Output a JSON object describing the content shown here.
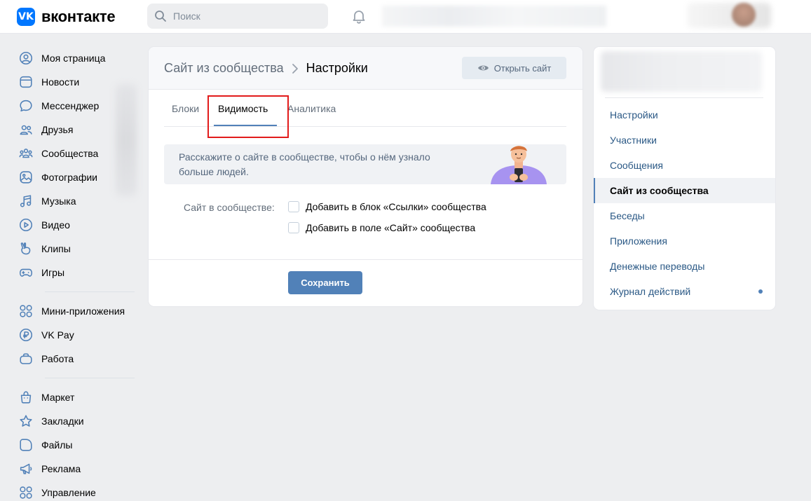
{
  "header": {
    "logo_badge": "VK",
    "logo_text": "вконтакте",
    "search_placeholder": "Поиск"
  },
  "nav": {
    "group1": [
      {
        "label": "Моя страница",
        "icon": "user-circle-icon"
      },
      {
        "label": "Новости",
        "icon": "news-icon"
      },
      {
        "label": "Мессенджер",
        "icon": "message-icon"
      },
      {
        "label": "Друзья",
        "icon": "friends-icon"
      },
      {
        "label": "Сообщества",
        "icon": "communities-icon"
      },
      {
        "label": "Фотографии",
        "icon": "photo-icon"
      },
      {
        "label": "Музыка",
        "icon": "music-icon"
      },
      {
        "label": "Видео",
        "icon": "video-icon"
      },
      {
        "label": "Клипы",
        "icon": "clips-icon"
      },
      {
        "label": "Игры",
        "icon": "gamepad-icon"
      }
    ],
    "group2": [
      {
        "label": "Мини-приложения",
        "icon": "mini-apps-icon"
      },
      {
        "label": "VK Pay",
        "icon": "vkpay-icon"
      },
      {
        "label": "Работа",
        "icon": "briefcase-icon"
      }
    ],
    "group3": [
      {
        "label": "Маркет",
        "icon": "market-icon"
      },
      {
        "label": "Закладки",
        "icon": "star-icon"
      },
      {
        "label": "Файлы",
        "icon": "file-icon"
      },
      {
        "label": "Реклама",
        "icon": "megaphone-icon"
      },
      {
        "label": "Управление",
        "icon": "grid-icon"
      }
    ]
  },
  "main": {
    "breadcrumb_parent": "Сайт из сообщества",
    "breadcrumb_current": "Настройки",
    "open_site_label": "Открыть сайт",
    "tabs": [
      {
        "label": "Блоки"
      },
      {
        "label": "Видимость"
      },
      {
        "label": "Аналитика"
      }
    ],
    "banner_text": "Расскажите о сайте в сообществе, чтобы о нём узнало больше людей.",
    "row_label": "Сайт в сообществе:",
    "options": [
      {
        "label": "Добавить в блок «Ссылки» сообщества",
        "checked": false
      },
      {
        "label": "Добавить в поле «Сайт» сообщества",
        "checked": false
      }
    ],
    "save_label": "Сохранить"
  },
  "right_menu": {
    "items": [
      {
        "label": "Настройки"
      },
      {
        "label": "Участники"
      },
      {
        "label": "Сообщения"
      },
      {
        "label": "Сайт из сообщества"
      },
      {
        "label": "Беседы"
      },
      {
        "label": "Приложения"
      },
      {
        "label": "Денежные переводы"
      },
      {
        "label": "Журнал действий"
      }
    ],
    "active_index": 3
  },
  "colors": {
    "accent": "#5181b8",
    "brand": "#0077ff",
    "highlight": "#e21b1b"
  }
}
